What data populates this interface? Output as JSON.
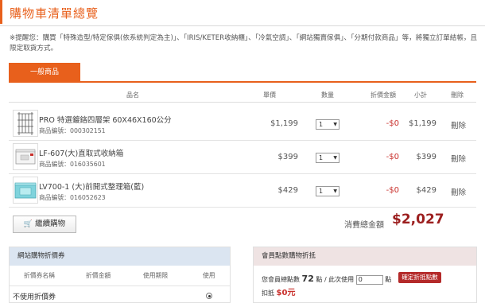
{
  "page": {
    "title": "購物車清單總覽"
  },
  "notice": "※提醒您：購買「特殊造型/特定傢俱(依系統判定為主)」、「IRIS/KETER收納櫃」、「冷氣空調」、「網站獨賣傢俱」、「分期付款商品」等，將獨立訂單結帳，且限定取貨方式。",
  "tabs": [
    {
      "label": "一般商品",
      "active": true
    }
  ],
  "table": {
    "headers": {
      "name": "品名",
      "price": "單價",
      "qty": "數量",
      "discount": "折價金額",
      "subtotal": "小計",
      "remove": "刪除"
    },
    "rows": [
      {
        "name": "PRO 特選鍍鉻四層架 60X46X160公分",
        "product_no": "商品編號：000302151",
        "price": "$1,199",
        "qty": "1",
        "discount": "-$0",
        "subtotal": "$1,199",
        "remove": "刪除",
        "thumb_icon": "wire-shelf-icon"
      },
      {
        "name": "LF-607(大)直取式收納箱",
        "product_no": "商品編號：016035601",
        "price": "$399",
        "qty": "1",
        "discount": "-$0",
        "subtotal": "$399",
        "remove": "刪除",
        "thumb_icon": "storage-box-icon"
      },
      {
        "name": "LV700-1 (大)前開式整理箱(藍)",
        "product_no": "商品編號：016052623",
        "price": "$429",
        "qty": "1",
        "discount": "-$0",
        "subtotal": "$429",
        "remove": "刪除",
        "thumb_icon": "blue-storage-box-icon"
      }
    ]
  },
  "actions": {
    "continue_label": "繼續購物",
    "continue_icon": "cart-icon"
  },
  "total": {
    "label": "消費總金額",
    "value": "$2,027"
  },
  "coupon_panel": {
    "title": "網站購物折價券",
    "columns": [
      "折價券名稱",
      "折價金額",
      "使用期限",
      "使用"
    ],
    "no_coupon_label": "不使用折價券",
    "no_coupon_selected": true
  },
  "points_panel": {
    "title": "會員點數購物折抵",
    "points_prefix": "您會員總點數",
    "points_value": "72",
    "points_mid": "點 / 此次使用",
    "points_input_value": "0",
    "points_suffix": "點",
    "apply_label": "確定折抵點數",
    "deduct_label": "扣抵",
    "deduct_value": "$0元"
  },
  "colors": {
    "accent": "#e8601c",
    "price_red": "#9c1f1f",
    "discount_red": "#c9302c",
    "coupon_head": "#dbe5f1",
    "points_head": "#efe3e3"
  }
}
